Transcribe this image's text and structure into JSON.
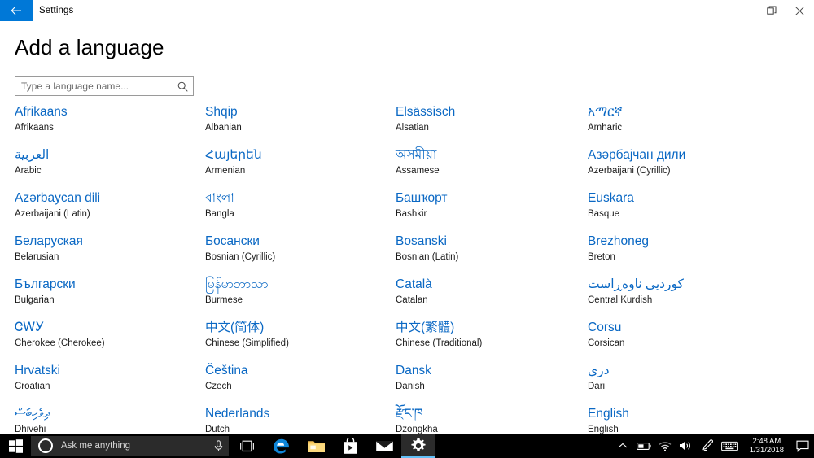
{
  "window": {
    "app_title": "Settings",
    "back_icon": "back-arrow-icon",
    "minimize_label": "–",
    "maximize_label": "❐",
    "close_label": "✕"
  },
  "page": {
    "heading": "Add a language"
  },
  "search": {
    "placeholder": "Type a language name...",
    "value": "",
    "icon": "search-icon"
  },
  "colors": {
    "accent": "#0078d7",
    "link_blue": "#0a68c4",
    "taskbar": "#000000",
    "cortana_box": "#2b2b2b",
    "active_underline": "#62c0f7"
  },
  "languages": {
    "columns": [
      [
        {
          "native": "Afrikaans",
          "english": "Afrikaans",
          "rtl": false
        },
        {
          "native": "العربية",
          "english": "Arabic",
          "rtl": true
        },
        {
          "native": "Azərbaycan dili",
          "english": "Azerbaijani (Latin)",
          "rtl": false
        },
        {
          "native": "Беларуская",
          "english": "Belarusian",
          "rtl": false
        },
        {
          "native": "Български",
          "english": "Bulgarian",
          "rtl": false
        },
        {
          "native": "ᏣᎳᎩ",
          "english": "Cherokee (Cherokee)",
          "rtl": false
        },
        {
          "native": "Hrvatski",
          "english": "Croatian",
          "rtl": false
        },
        {
          "native": "ދިވެހިބަސް",
          "english": "Dhivehi",
          "rtl": true
        }
      ],
      [
        {
          "native": "Shqip",
          "english": "Albanian",
          "rtl": false
        },
        {
          "native": "Հայերեն",
          "english": "Armenian",
          "rtl": false
        },
        {
          "native": "বাংলা",
          "english": "Bangla",
          "rtl": false
        },
        {
          "native": "Босански",
          "english": "Bosnian (Cyrillic)",
          "rtl": false
        },
        {
          "native": "မြန်မာဘာသာ",
          "english": "Burmese",
          "rtl": false
        },
        {
          "native": "中文(简体)",
          "english": "Chinese (Simplified)",
          "rtl": false
        },
        {
          "native": "Čeština",
          "english": "Czech",
          "rtl": false
        },
        {
          "native": "Nederlands",
          "english": "Dutch",
          "rtl": false
        }
      ],
      [
        {
          "native": "Elsässisch",
          "english": "Alsatian",
          "rtl": false
        },
        {
          "native": "অসমীয়া",
          "english": "Assamese",
          "rtl": false
        },
        {
          "native": "Башҡорт",
          "english": "Bashkir",
          "rtl": false
        },
        {
          "native": "Bosanski",
          "english": "Bosnian (Latin)",
          "rtl": false
        },
        {
          "native": "Català",
          "english": "Catalan",
          "rtl": false
        },
        {
          "native": "中文(繁體)",
          "english": "Chinese (Traditional)",
          "rtl": false
        },
        {
          "native": "Dansk",
          "english": "Danish",
          "rtl": false
        },
        {
          "native": "རྫོང་ཁ",
          "english": "Dzongkha",
          "rtl": false
        }
      ],
      [
        {
          "native": "አማርኛ",
          "english": "Amharic",
          "rtl": false
        },
        {
          "native": "Азәрбајчан дили",
          "english": "Azerbaijani (Cyrillic)",
          "rtl": false
        },
        {
          "native": "Euskara",
          "english": "Basque",
          "rtl": false
        },
        {
          "native": "Brezhoneg",
          "english": "Breton",
          "rtl": false
        },
        {
          "native": "کوردیی ناوەڕاست",
          "english": "Central Kurdish",
          "rtl": true
        },
        {
          "native": "Corsu",
          "english": "Corsican",
          "rtl": false
        },
        {
          "native": "دری",
          "english": "Dari",
          "rtl": true
        },
        {
          "native": "English",
          "english": "English",
          "rtl": false
        }
      ]
    ]
  },
  "taskbar": {
    "start_label": "start-button",
    "cortana_placeholder": "Ask me anything",
    "mic_icon": "microphone-icon",
    "taskview_icon": "task-view-icon",
    "apps": [
      {
        "name": "edge",
        "label": "Microsoft Edge",
        "active": false
      },
      {
        "name": "file-explorer",
        "label": "File Explorer",
        "active": false
      },
      {
        "name": "store",
        "label": "Microsoft Store",
        "active": false
      },
      {
        "name": "mail",
        "label": "Mail",
        "active": false
      },
      {
        "name": "settings",
        "label": "Settings",
        "active": true
      }
    ],
    "tray": [
      {
        "name": "show-hidden-icons",
        "label": "Show hidden icons"
      },
      {
        "name": "battery",
        "label": "Battery"
      },
      {
        "name": "network",
        "label": "Network"
      },
      {
        "name": "volume",
        "label": "Volume"
      },
      {
        "name": "pen-workspace",
        "label": "Windows Ink Workspace"
      },
      {
        "name": "touch-keyboard",
        "label": "Touch keyboard"
      }
    ],
    "clock": {
      "time": "2:48 AM",
      "date": "1/31/2018"
    },
    "action_center_icon": "action-center-icon"
  }
}
